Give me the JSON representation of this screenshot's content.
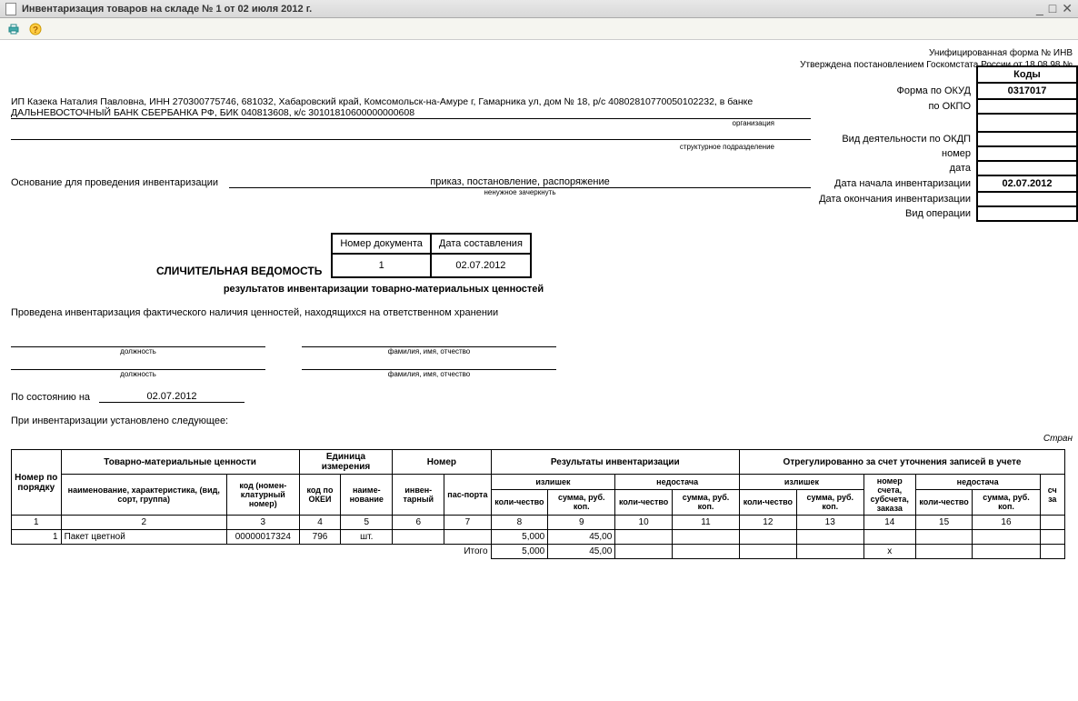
{
  "window": {
    "title": "Инвентаризация товаров на складе № 1 от 02 июля 2012 г."
  },
  "form_header": {
    "unified_form": "Унифицированная форма № ИНВ",
    "approved": "Утверждена постановлением Госкомстата России от 18.08.98 №"
  },
  "codes": {
    "header": "Коды",
    "form_okud_label": "Форма по ОКУД",
    "form_okud_value": "0317017",
    "okpo_label": "по ОКПО",
    "okpo_value": "",
    "okdp_label": "Вид деятельности по ОКДП",
    "okdp_value": "",
    "number_label": "номер",
    "number_value": "",
    "date_label": "дата",
    "date_value": "",
    "start_date_label": "Дата начала инвентаризации",
    "start_date_value": "02.07.2012",
    "end_date_label": "Дата окончания инвентаризации",
    "end_date_value": "",
    "op_type_label": "Вид операции",
    "op_type_value": ""
  },
  "org": {
    "line1": "ИП Казека Наталия Павловна, ИНН 270300775746, 681032, Хабаровский край, Комсомольск-на-Амуре г, Гамарника ул, дом № 18, р/с 40802810770050102232, в банке",
    "line2": "ДАЛЬНЕВОСТОЧНЫЙ БАНК СБЕРБАНКА РФ, БИК 040813608, к/с 30101810600000000608",
    "caption_org": "организация",
    "caption_struct": "структурное подразделение"
  },
  "basis": {
    "label": "Основание для проведения инвентаризации",
    "value": "приказ, постановление, распоряжение",
    "caption": "ненужное зачеркнуть"
  },
  "doc_num_block": {
    "col1": "Номер документа",
    "col2": "Дата составления",
    "num": "1",
    "date": "02.07.2012",
    "title": "СЛИЧИТЕЛЬНАЯ ВЕДОМОСТЬ",
    "subtitle": "результатов инвентаризации товарно-материальных ценностей"
  },
  "intro": "Проведена инвентаризация фактического наличия ценностей, находящихся на ответственном хранении",
  "sign": {
    "position": "должность",
    "fio": "фамилия, имя, отчество"
  },
  "state": {
    "label": "По состоянию на",
    "value": "02.07.2012"
  },
  "established": "При инвентаризации установлено следующее:",
  "page_label": "Стран",
  "table": {
    "h_num": "Номер по порядку",
    "h_tmc": "Товарно-материальные ценности",
    "h_unit": "Единица измерения",
    "h_number": "Номер",
    "h_results": "Результаты инвентаризации",
    "h_adjusted": "Отрегулированно за счет уточнения записей в учете",
    "h_name": "наименование, характеристика, (вид, сорт, группа)",
    "h_nomcode": "код (номен-клатурный номер)",
    "h_okei": "код по ОКЕИ",
    "h_unitname": "наиме-нование",
    "h_inv": "инвен-тарный",
    "h_passport": "пас-порта",
    "h_surplus": "излишек",
    "h_shortage": "недостача",
    "h_qty": "коли-чество",
    "h_sum": "сумма, руб. коп.",
    "h_acc": "номер счета, субсчета, заказа",
    "h_col_sc": "сч",
    "h_col_za": "за",
    "col_nums": [
      "1",
      "2",
      "3",
      "4",
      "5",
      "6",
      "7",
      "8",
      "9",
      "10",
      "11",
      "12",
      "13",
      "14",
      "15",
      "16"
    ],
    "row": {
      "n": "1",
      "name": "Пакет цветной",
      "code": "00000017324",
      "okei": "796",
      "unit": "шт.",
      "inv": "",
      "pass": "",
      "surplus_qty": "5,000",
      "surplus_sum": "45,00",
      "short_qty": "",
      "short_sum": "",
      "adj_s_qty": "",
      "adj_s_sum": "",
      "adj_acc": "",
      "adj_sh_qty": "",
      "adj_sh_sum": ""
    },
    "total_label": "Итого",
    "total_qty": "5,000",
    "total_sum": "45,00",
    "total_x": "х"
  }
}
